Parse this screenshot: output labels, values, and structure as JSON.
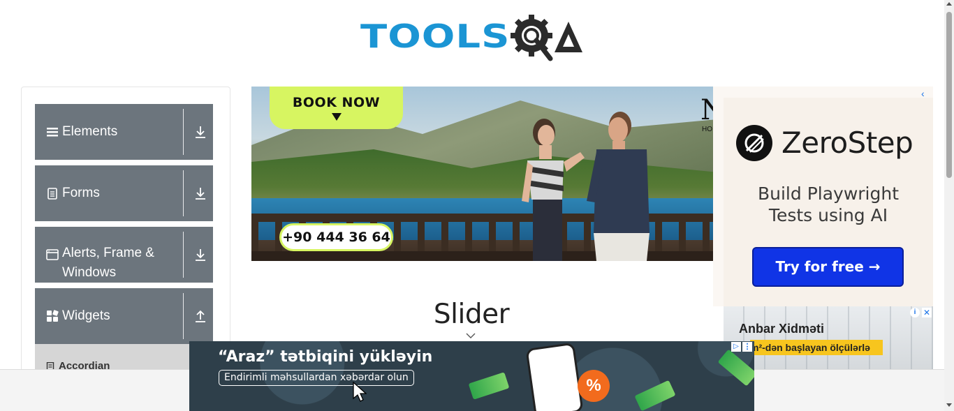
{
  "header": {
    "logo_text": "TOOLS",
    "logo_suffix": "QA"
  },
  "sidebar": {
    "groups": [
      {
        "label": "Elements",
        "icon": "hamburger-icon",
        "arrow": "download-arrow-icon"
      },
      {
        "label": "Forms",
        "icon": "form-document-icon",
        "arrow": "download-arrow-icon"
      },
      {
        "label": "Alerts, Frame & Windows",
        "icon": "browser-window-icon",
        "arrow": "download-arrow-icon"
      },
      {
        "label": "Widgets",
        "icon": "widgets-grid-icon",
        "arrow": "upload-arrow-icon"
      }
    ],
    "active_item": {
      "label": "Accordian",
      "icon": "bookmark-icon"
    }
  },
  "banner_ad": {
    "cta": "BOOK NOW",
    "phone": "+90 444 36 64",
    "brand_letter": "N",
    "brand_small": "HO",
    "cta_color": "#d7f561"
  },
  "right_ad": {
    "brand": "ZeroStep",
    "tagline_line1": "Build Playwright",
    "tagline_line2": "Tests using AI",
    "button": "Try for free →",
    "button_color": "#1034e6"
  },
  "small_ad": {
    "title": "Anbar Xidməti",
    "subtitle": "m²-dən başlayan ölçülərlə"
  },
  "main": {
    "page_title": "Slider"
  },
  "bottom_ad": {
    "title": "“Araz” tətbiqini yükləyin",
    "subtitle": "Endirimli məhsullardan xəbərdar olun",
    "badge": "%"
  },
  "colors": {
    "accent": "#1b95d4",
    "sidebar_header": "#6c757d",
    "active_item_bg": "#d6d6d6"
  }
}
